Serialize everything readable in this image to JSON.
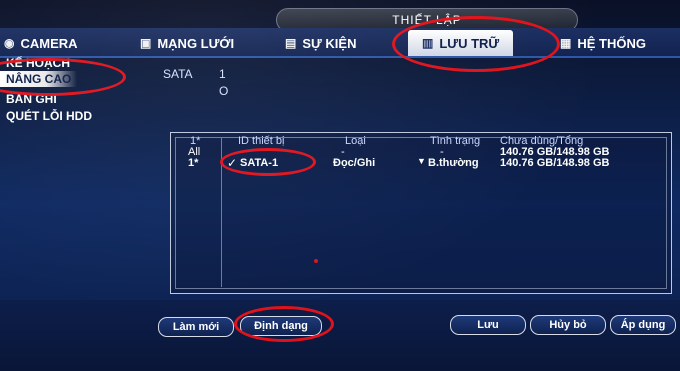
{
  "window": {
    "title": "THIẾT LẬP"
  },
  "tabs": [
    {
      "label": "CAMERA",
      "icon": "camera-icon"
    },
    {
      "label": "MẠNG LƯỚI",
      "icon": "network-icon"
    },
    {
      "label": "SỰ KIỆN",
      "icon": "event-icon"
    },
    {
      "label": "LƯU TRỮ",
      "icon": "storage-icon",
      "active": true
    },
    {
      "label": "HỆ THỐNG",
      "icon": "system-icon"
    }
  ],
  "sidebar": {
    "items": [
      {
        "label": "KẾ HOẠCH"
      },
      {
        "label": "NÂNG CAO",
        "active": true
      },
      {
        "label": "BẢN GHI"
      },
      {
        "label": "QUÉT LỖI HDD"
      }
    ]
  },
  "hdd_group": {
    "label": "SATA",
    "value_top": "1",
    "value_bottom": "O"
  },
  "table": {
    "headers": [
      "1*",
      "ID thiết bị",
      "Loại",
      "Tình trạng",
      "Chưa dùng/Tổng"
    ],
    "rows": [
      {
        "col0": "All",
        "id": "",
        "type": "-",
        "status": "-",
        "capacity": "140.76 GB/148.98 GB"
      },
      {
        "col0": "1*",
        "id": "SATA-1",
        "type": "Đọc/Ghi",
        "status": "B.thường",
        "capacity": "140.76 GB/148.98 GB"
      }
    ]
  },
  "buttons": {
    "refresh": "Làm mới",
    "format": "Định dạng",
    "save": "Lưu",
    "cancel": "Hủy bỏ",
    "apply": "Áp dụng"
  },
  "colors": {
    "background": "#0f2a62",
    "annotation_red": "#e0121b",
    "active_tab": "#ffffff"
  }
}
